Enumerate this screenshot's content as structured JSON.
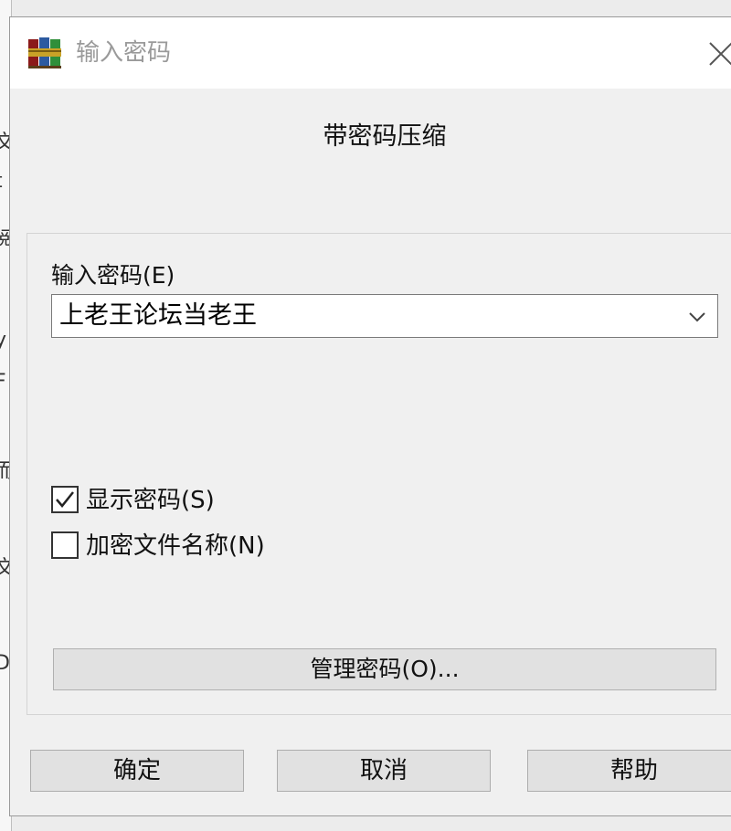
{
  "window": {
    "title": "输入密码",
    "icon": "winrar-books-icon"
  },
  "heading": "带密码压缩",
  "password": {
    "label": "输入密码(E)",
    "value": "上老王论坛当老王"
  },
  "options": {
    "show_password": {
      "label": "显示密码(S)",
      "checked": true
    },
    "encrypt_filenames": {
      "label": "加密文件名称(N)",
      "checked": false
    }
  },
  "manage_button": "管理密码(O)...",
  "buttons": {
    "ok": "确定",
    "cancel": "取消",
    "help": "帮助"
  },
  "background_fragments": [
    "文",
    "t",
    "阅",
    "y",
    "F",
    "而",
    "文",
    "D"
  ]
}
